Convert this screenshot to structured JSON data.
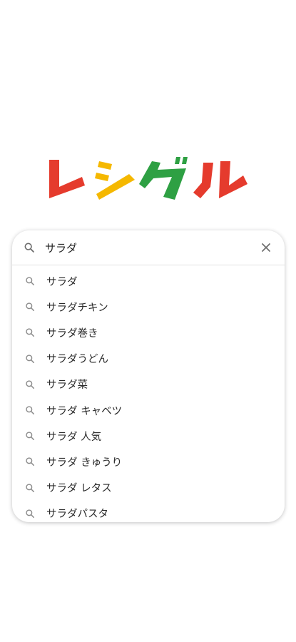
{
  "brand": {
    "logo_text": "レシグル",
    "colors": [
      "#e53b2d",
      "#f5b800",
      "#2ea043",
      "#e53b2d"
    ]
  },
  "search": {
    "query": "サラダ",
    "icon": "search-icon",
    "clear_icon": "close-icon"
  },
  "suggestions": [
    {
      "text": "サラダ"
    },
    {
      "text": "サラダチキン"
    },
    {
      "text": "サラダ巻き"
    },
    {
      "text": "サラダうどん"
    },
    {
      "text": "サラダ菜"
    },
    {
      "text": "サラダ キャベツ"
    },
    {
      "text": "サラダ 人気"
    },
    {
      "text": "サラダ きゅうり"
    },
    {
      "text": "サラダ レタス"
    },
    {
      "text": "サラダパスタ"
    }
  ]
}
